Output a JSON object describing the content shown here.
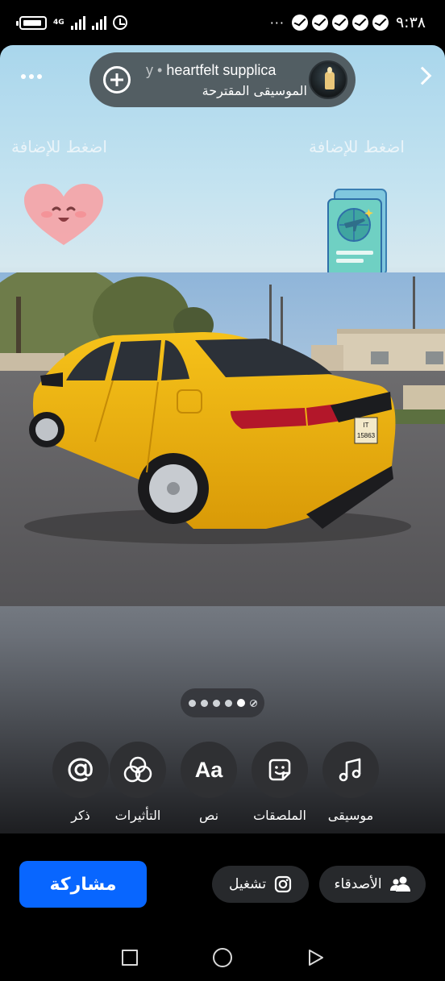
{
  "status_bar": {
    "time": "٩:٣٨",
    "network_label": "4G",
    "overflow": "···",
    "notification_icons": [
      "messenger-icon",
      "messenger-icon",
      "messenger-icon",
      "messenger-icon",
      "messenger-icon"
    ]
  },
  "story_editor": {
    "music": {
      "track_prefix": "y • ",
      "track_title": "heartfelt supplica",
      "subtitle": "الموسيقى المقترحة"
    },
    "sticker_hint_left": "اضغط للإضافة",
    "sticker_hint_right": "اضغط للإضافة",
    "page_indicator": {
      "count": 5,
      "active_index": 4
    },
    "tools": [
      {
        "id": "mention",
        "label": "ذكر",
        "icon": "at-sign-icon"
      },
      {
        "id": "effects",
        "label": "التأثيرات",
        "icon": "effects-icon"
      },
      {
        "id": "text",
        "label": "نص",
        "icon": "text-icon",
        "glyph": "Aa"
      },
      {
        "id": "stickers",
        "label": "الملصقات",
        "icon": "sticker-icon"
      },
      {
        "id": "music",
        "label": "موسيقى",
        "icon": "music-note-icon"
      }
    ]
  },
  "bottom_bar": {
    "share_label": "مشاركة",
    "play_label": "تشغيل",
    "friends_label": "الأصدقاء"
  },
  "photo": {
    "plate_top": "IT",
    "plate_number": "15863"
  },
  "colors": {
    "share_button": "#0866ff",
    "chip_background": "#27292c",
    "tool_circle": "#2f3033",
    "car_body": "#f2b50f"
  }
}
